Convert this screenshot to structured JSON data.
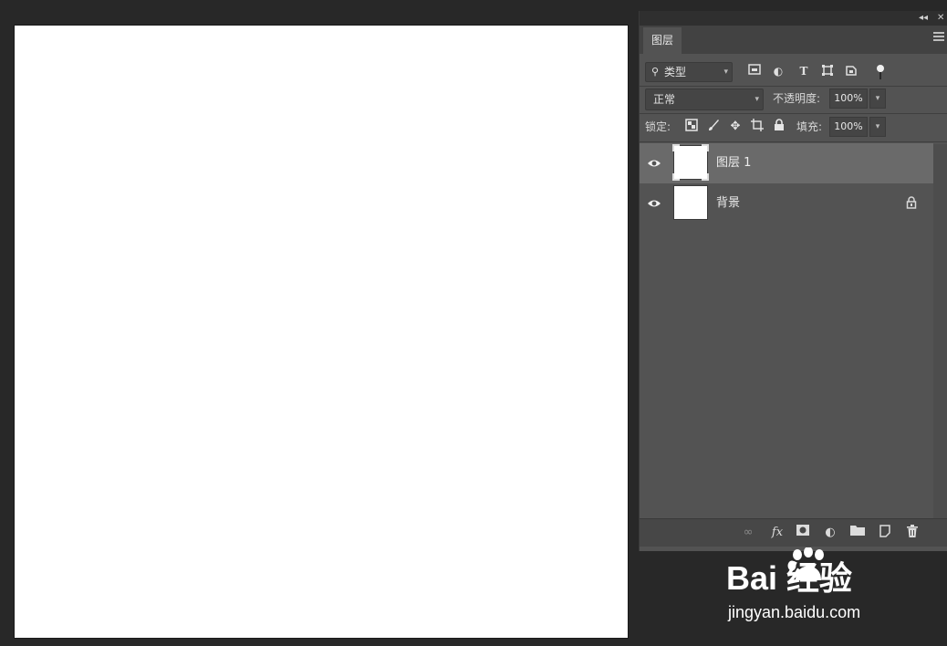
{
  "panel": {
    "collapse_label": "◂◂",
    "close_label": "✕",
    "tab_label": "图层",
    "filter": {
      "selected": "类型",
      "icons": [
        "image-filter-icon",
        "adjustment-filter-icon",
        "type-filter-icon",
        "shape-filter-icon",
        "smart-object-filter-icon",
        "filter-toggle-icon"
      ]
    },
    "blend_mode": "正常",
    "opacity_label": "不透明度:",
    "opacity_value": "100%",
    "lock_label": "锁定:",
    "fill_label": "填充:",
    "fill_value": "100%",
    "layers": [
      {
        "name": "图层 1",
        "selected": true,
        "locked": false
      },
      {
        "name": "背景",
        "selected": false,
        "locked": true
      }
    ],
    "bottom_icons": [
      "link-layers-icon",
      "fx-icon",
      "add-mask-icon",
      "adjustment-layer-icon",
      "new-group-icon",
      "new-layer-icon",
      "delete-icon"
    ],
    "fx_label": "fx"
  },
  "watermark": {
    "logo_text": "Bai 经验",
    "url_text": "jingyan.baidu.com"
  }
}
